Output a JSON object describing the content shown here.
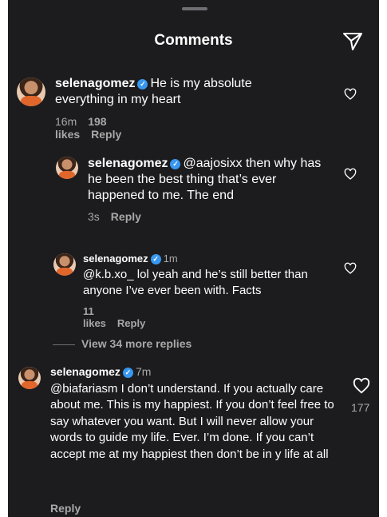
{
  "header": {
    "title": "Comments"
  },
  "comments": [
    {
      "username": "selenagomez",
      "text": "He is my absolute everything in my heart",
      "time": "16m",
      "likes": "198 likes",
      "reply": "Reply"
    },
    {
      "username": "selenagomez",
      "text": "@aajosixx then why has he been the best thing that’s ever happened to me. The end",
      "time": "3s",
      "reply": "Reply"
    },
    {
      "username": "selenagomez",
      "time": "1m",
      "text": "@k.b.xo_ lol yeah and he’s still better than anyone I’ve ever been with. Facts",
      "likes": "11 likes",
      "reply": "Reply"
    },
    {
      "username": "selenagomez",
      "time": "7m",
      "text": "@biafariasm I don’t understand. If you actually care about me. This is my happiest. If you don’t feel free to say whatever you want. But I will never allow your words to guide my life. Ever. I’m done. If you can’t accept me at my happiest then don’t be in y life at all",
      "like_count": "177",
      "reply": "Reply"
    }
  ],
  "view_more": "View 34 more replies",
  "icons": {
    "share": "paper-plane-icon",
    "heart": "heart-icon",
    "verified": "verified-badge-icon"
  },
  "colors": {
    "background": "#1c1c1e",
    "muted": "#a8a8a8",
    "verified": "#3897f0"
  }
}
